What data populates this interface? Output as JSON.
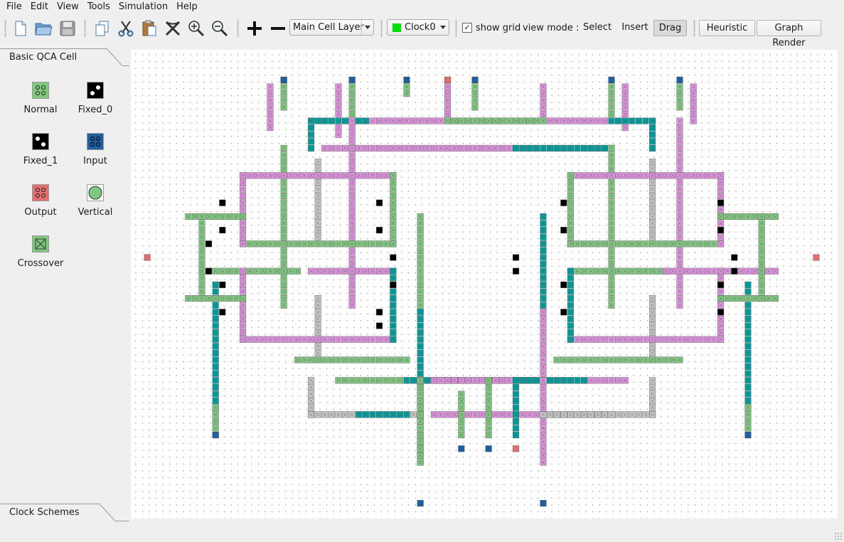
{
  "menu": {
    "items": [
      {
        "label": "File"
      },
      {
        "label": "Edit"
      },
      {
        "label": "View"
      },
      {
        "label": "Tools"
      },
      {
        "label": "Simulation"
      },
      {
        "label": "Help"
      }
    ]
  },
  "toolbar": {
    "layer_select": "Main Cell Layer",
    "clock_select": "Clock0",
    "clock_color": "#00e000",
    "show_grid_label": "show grid",
    "show_grid_checked": "✓",
    "view_mode_label": "view mode :",
    "select_label": "Select",
    "insert_label": "Insert",
    "drag_label": "Drag",
    "heuristic_label": "Heuristic",
    "graph_render_label": "Graph Render"
  },
  "sidebar": {
    "panel_title": "Basic QCA Cell",
    "tools": [
      {
        "label": "Normal",
        "icon": "normal-cell-icon"
      },
      {
        "label": "Fixed_0",
        "icon": "fixed0-cell-icon"
      },
      {
        "label": "Fixed_1",
        "icon": "fixed1-cell-icon"
      },
      {
        "label": "Input",
        "icon": "input-cell-icon"
      },
      {
        "label": "Output",
        "icon": "output-cell-icon"
      },
      {
        "label": "Vertical",
        "icon": "vertical-cell-icon"
      },
      {
        "label": "Crossover",
        "icon": "crossover-cell-icon"
      }
    ],
    "bottom_panel_title": "Clock Schemes"
  },
  "colors": {
    "clock0": "#7fc97f",
    "clock1": "#e090e0",
    "clock2": "#00a0a0",
    "clock3": "#c8c8c8",
    "input": "#1e5fa0",
    "output": "#e07070",
    "fixed": "#000000"
  }
}
